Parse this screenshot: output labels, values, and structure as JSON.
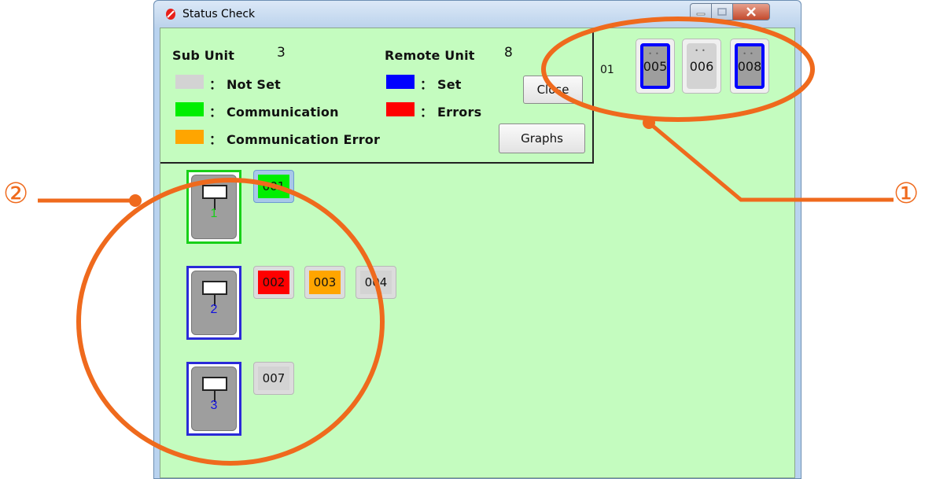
{
  "window": {
    "title": "Status Check"
  },
  "legend": {
    "sub_unit_label": "Sub Unit",
    "sub_unit_count": "3",
    "remote_unit_label": "Remote Unit",
    "remote_unit_count": "8",
    "items": [
      {
        "text": "： Not Set",
        "color": "#d3d3d3"
      },
      {
        "text": "： Communication",
        "color": "#00ee00"
      },
      {
        "text": "： Communication Error",
        "color": "#ffa500"
      },
      {
        "text": "： Set",
        "color": "#0000ff"
      },
      {
        "text": "： Errors",
        "color": "#ff0000"
      }
    ],
    "close_label": "Close",
    "graphs_label": "Graphs"
  },
  "remote_row": {
    "label": "01",
    "units": [
      {
        "id": "005",
        "status": "set"
      },
      {
        "id": "006",
        "status": "not-set"
      },
      {
        "id": "008",
        "status": "set"
      }
    ]
  },
  "sub_units": [
    {
      "number": "1",
      "units": [
        {
          "id": "001",
          "status": "communication"
        }
      ]
    },
    {
      "number": "2",
      "units": [
        {
          "id": "002",
          "status": "errors"
        },
        {
          "id": "003",
          "status": "communication-error"
        },
        {
          "id": "004",
          "status": "not-set"
        }
      ]
    },
    {
      "number": "3",
      "units": [
        {
          "id": "007",
          "status": "not-set"
        }
      ]
    }
  ],
  "annotations": {
    "marker_1": "①",
    "marker_2": "②"
  },
  "colors": {
    "accent": "#ef6a1d",
    "background": "#c4fcbf"
  }
}
